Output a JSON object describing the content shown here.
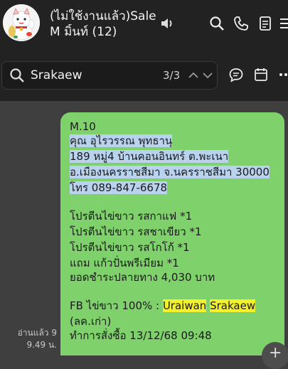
{
  "header": {
    "title_line1": "(ไม่ใช้งานแล้ว)Sale",
    "title_line2": "M    มิ้นท์ (12)"
  },
  "search": {
    "query": "Srakaew",
    "counter": "3/3"
  },
  "message": {
    "lines": [
      "M.10",
      "คุณ อุไรวรรณ พุทธานุ",
      "189 หมู่4 บ้านคอนอินทร์ ต.พะเนา",
      "อ.เมืองนครราชสีมา จ.นครราชสีมา 30000",
      "โทร 089-847-6678",
      "",
      "โปรตีนไข่ขาว รสกาแฟ *1",
      "โปรตีนไข่ขาว รสชาเขียว *1",
      "โปรตีนไข่ขาว รสโกโก้ *1",
      "แถม แก้วปั่นพรีเมียม *1",
      "ยอดชำระปลายทาง 4,030 บาท",
      "",
      "FB ไข่ขาว 100% : ",
      "(ลค.เก่า)",
      "ทำการสั่งซื้อ 13/12/68 09:48"
    ],
    "fb_hit_1": "Uraiwan",
    "fb_hit_2": "Srakaew",
    "read_status": "อ่านแล้ว 9",
    "time": "9.49 น."
  },
  "icons": {
    "speaker": "speaker-icon",
    "search": "search-icon",
    "call": "phone-icon",
    "notes": "notes-icon",
    "menu": "menu-icon",
    "chat": "chat-icon",
    "calendar": "calendar-icon",
    "more": "more-icon",
    "up": "chevron-up-icon",
    "down": "chevron-down-icon"
  }
}
